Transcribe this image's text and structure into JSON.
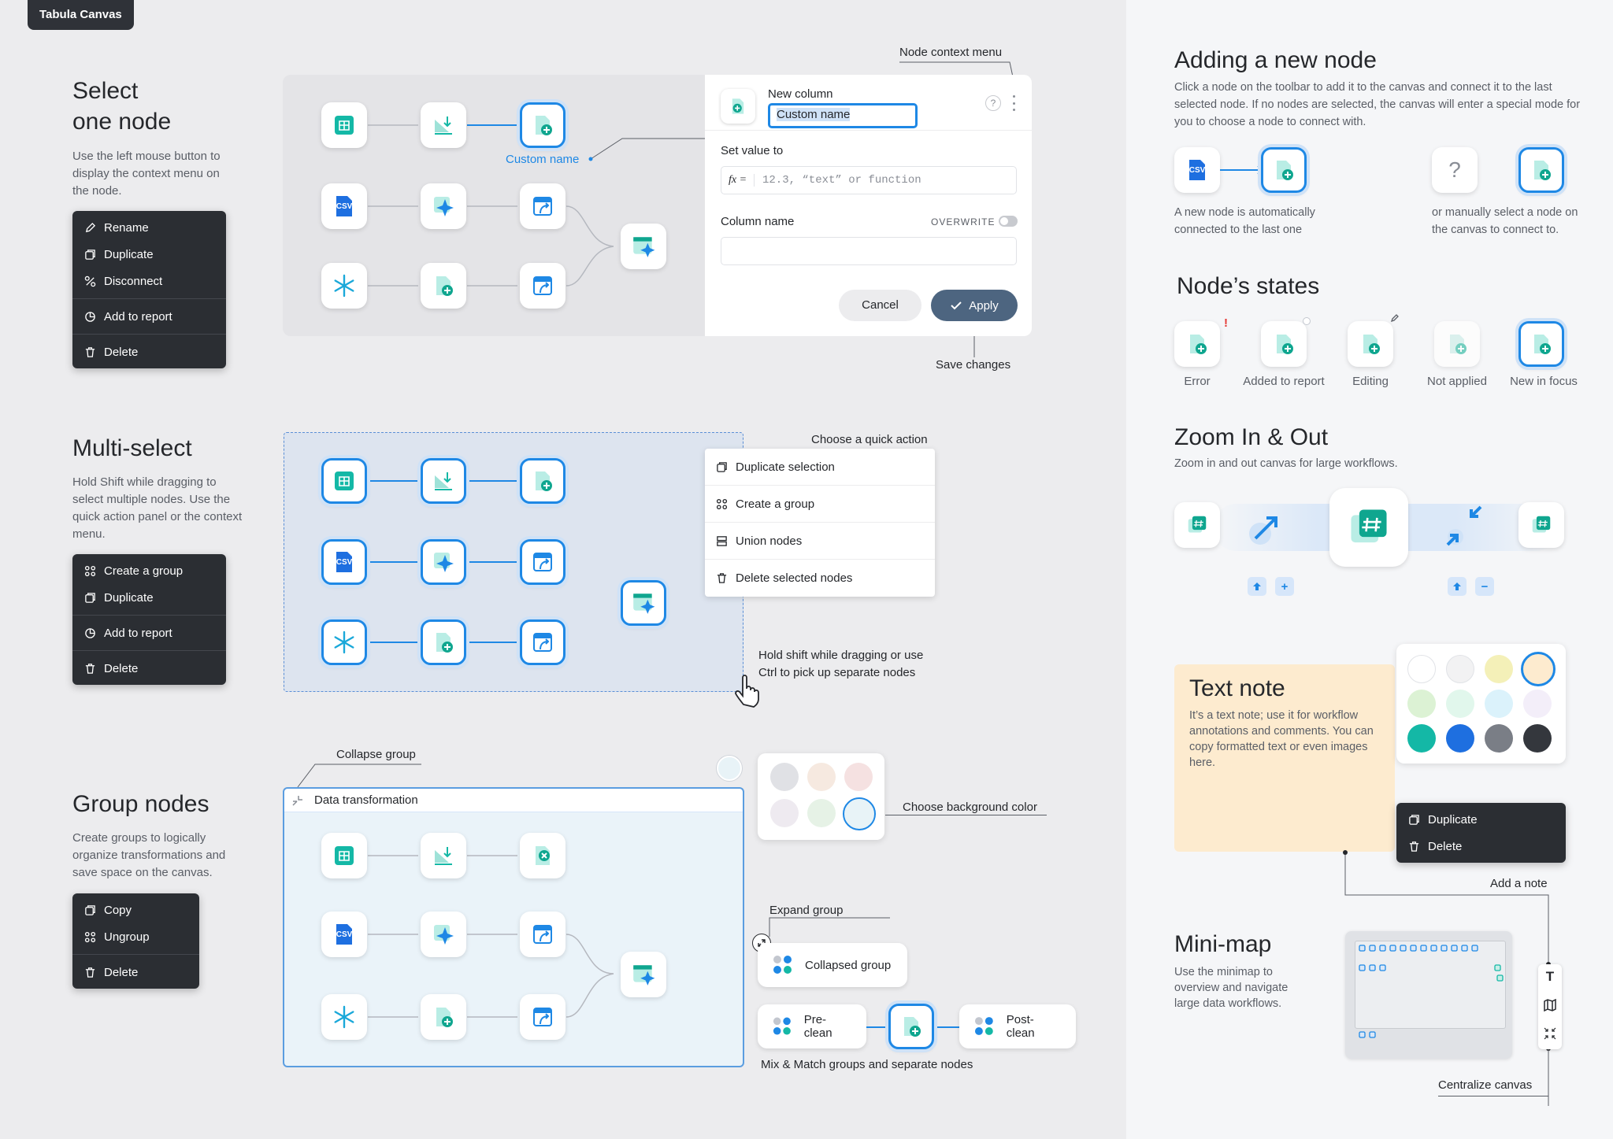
{
  "app": {
    "title": "Tabula Canvas"
  },
  "select": {
    "title_l1": "Select",
    "title_l2": "one node",
    "desc": "Use the left mouse button to display the context menu on the node.",
    "menu": {
      "rename": "Rename",
      "duplicate": "Duplicate",
      "disconnect": "Disconnect",
      "add_report": "Add to report",
      "delete": "Delete"
    },
    "custom_name_label": "Custom name"
  },
  "ctx": {
    "header": "Node context menu",
    "new_column": "New column",
    "custom_name_value": "Custom name",
    "set_value": "Set value to",
    "fx": "fx =",
    "value_placeholder": "12.3, “text” or function",
    "column_name": "Column name",
    "overwrite": "OVERWRITE",
    "cancel": "Cancel",
    "apply": "Apply",
    "save_changes": "Save changes",
    "help": "?"
  },
  "multi": {
    "title": "Multi-select",
    "desc": "Hold Shift while dragging to select multiple nodes. Use the quick action panel or the context menu.",
    "menu": {
      "group": "Create a group",
      "duplicate": "Duplicate",
      "add_report": "Add to report",
      "delete": "Delete"
    },
    "quick_header": "Choose a quick action",
    "quick": {
      "dup": "Duplicate selection",
      "group": "Create a group",
      "union": "Union nodes",
      "delete": "Delete selected nodes"
    },
    "shift_note_l1": "Hold shift while dragging or use",
    "shift_note_l2": "Ctrl to pick up separate nodes"
  },
  "group": {
    "title": "Group nodes",
    "desc": "Create groups to logically organize transformations and save space on the canvas.",
    "menu": {
      "copy": "Copy",
      "ungroup": "Ungroup",
      "delete": "Delete"
    },
    "collapse_label": "Collapse group",
    "group_name": "Data transformation",
    "bg_label": "Choose background color",
    "expand_label": "Expand group",
    "collapsed_group": "Collapsed group",
    "pre_clean": "Pre-clean",
    "post_clean": "Post-clean",
    "mix_label": "Mix & Match groups and separate nodes"
  },
  "adding": {
    "title": "Adding a new node",
    "desc": "Click a node on the toolbar to add it to the canvas and connect it to the last selected node. If no nodes are selected, the canvas will enter a special mode for you to choose a node to connect with.",
    "auto_l1": "A new node is automatically",
    "auto_l2": "connected to the last one",
    "manual_l1": "or manually select a node on",
    "manual_l2": "the canvas to connect to.",
    "q": "?"
  },
  "states": {
    "title": "Node’s states",
    "items": [
      "Error",
      "Added to report",
      "Editing",
      "Not applied",
      "New in focus"
    ]
  },
  "zoom": {
    "title": "Zoom In & Out",
    "desc": "Zoom in and out canvas for large workflows.",
    "plus": "+",
    "minus": "−"
  },
  "note": {
    "title": "Text note",
    "body": "It’s a text note; use it for workflow annotations and comments. You can copy formatted text or even images here.",
    "menu": {
      "duplicate": "Duplicate",
      "delete": "Delete"
    },
    "add_note": "Add a note"
  },
  "minimap": {
    "title": "Mini-map",
    "desc": "Use the minimap to overview and navigate large data workflows.",
    "centralize": "Centralize canvas",
    "t": "T"
  },
  "csv": "CSV",
  "colors": {
    "accent": "#1e88e5",
    "teal": "#14b8a6",
    "dark": "#2b2e33"
  }
}
